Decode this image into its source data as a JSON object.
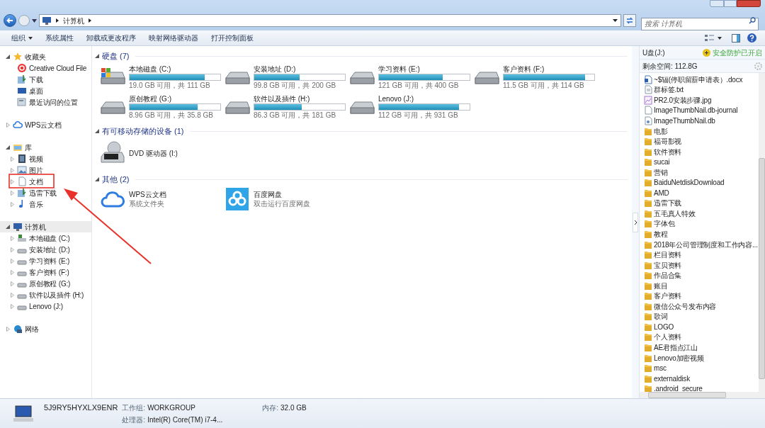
{
  "address": {
    "crumbs": [
      "计算机"
    ]
  },
  "search": {
    "placeholder": "搜索 计算机"
  },
  "toolbar": [
    {
      "label": "组织",
      "dropdown": true
    },
    {
      "label": "系统属性",
      "dropdown": false
    },
    {
      "label": "卸载或更改程序",
      "dropdown": false
    },
    {
      "label": "映射网络驱动器",
      "dropdown": false
    },
    {
      "label": "打开控制面板",
      "dropdown": false
    }
  ],
  "sidebar": [
    {
      "label": "收藏夹",
      "kind": "star",
      "expanded": true,
      "selected": false,
      "children": [
        {
          "label": "Creative Cloud File",
          "kind": "cloud-red",
          "selected": false
        },
        {
          "label": "下载",
          "kind": "download",
          "selected": false
        },
        {
          "label": "桌面",
          "kind": "desktop",
          "selected": false
        },
        {
          "label": "最近访问的位置",
          "kind": "recent",
          "selected": false
        }
      ]
    },
    {
      "label": "WPS云文档",
      "kind": "cloud",
      "expanded": false,
      "selected": false
    },
    {
      "label": "库",
      "kind": "library",
      "expanded": true,
      "selected": false,
      "children": [
        {
          "label": "视频",
          "kind": "video",
          "expanded": false,
          "selected": false
        },
        {
          "label": "图片",
          "kind": "picture",
          "expanded": false,
          "selected": false
        },
        {
          "label": "文档",
          "kind": "document",
          "expanded": false,
          "selected": false
        },
        {
          "label": "迅雷下载",
          "kind": "download",
          "expanded": false,
          "selected": false
        },
        {
          "label": "音乐",
          "kind": "music",
          "expanded": false,
          "selected": false
        }
      ]
    },
    {
      "label": "计算机",
      "kind": "computer",
      "expanded": true,
      "selected": true,
      "children": [
        {
          "label": "本地磁盘 (C:)",
          "kind": "system-drive",
          "expanded": false,
          "selected": false
        },
        {
          "label": "安装地址 (D:)",
          "kind": "drive",
          "expanded": false,
          "selected": false
        },
        {
          "label": "学习资料 (E:)",
          "kind": "drive",
          "expanded": false,
          "selected": false
        },
        {
          "label": "客户资料 (F:)",
          "kind": "drive",
          "expanded": false,
          "selected": false
        },
        {
          "label": "原创教程 (G:)",
          "kind": "drive",
          "expanded": false,
          "selected": false
        },
        {
          "label": "软件以及插件 (H:)",
          "kind": "drive",
          "expanded": false,
          "selected": false
        },
        {
          "label": "Lenovo (J:)",
          "kind": "drive",
          "expanded": false,
          "selected": false
        }
      ]
    },
    {
      "label": "网络",
      "kind": "network",
      "expanded": false,
      "selected": false
    }
  ],
  "groups": [
    {
      "title": "硬盘 (7)",
      "kind": "drives",
      "items": [
        {
          "name": "本地磁盘 (C:)",
          "kind": "system-drive",
          "level": 0.83,
          "info": "19.0 GB 可用，共 111 GB"
        },
        {
          "name": "安装地址 (D:)",
          "kind": "drive",
          "level": 0.5,
          "info": "99.8 GB 可用，共 200 GB"
        },
        {
          "name": "学习资料 (E:)",
          "kind": "drive",
          "level": 0.7,
          "info": "121 GB 可用，共 400 GB"
        },
        {
          "name": "客户资料 (F:)",
          "kind": "drive",
          "level": 0.9,
          "info": "11.5 GB 可用，共 114 GB"
        },
        {
          "name": "原创教程 (G:)",
          "kind": "drive",
          "level": 0.75,
          "info": "8.96 GB 可用，共 35.8 GB"
        },
        {
          "name": "软件以及插件 (H:)",
          "kind": "drive",
          "level": 0.52,
          "info": "86.3 GB 可用，共 181 GB"
        },
        {
          "name": "Lenovo (J:)",
          "kind": "drive",
          "level": 0.88,
          "info": "112 GB 可用，共 931 GB"
        }
      ]
    },
    {
      "title": "有可移动存储的设备 (1)",
      "kind": "devices",
      "items": [
        {
          "name": "DVD 驱动器 (I:)",
          "kind": "dvd"
        }
      ]
    },
    {
      "title": "其他 (2)",
      "kind": "others",
      "items": [
        {
          "name": "WPS云文档",
          "kind": "cloud",
          "info": "系统文件夹"
        },
        {
          "name": "百度网盘",
          "kind": "baidu",
          "info": "双击运行百度网盘"
        }
      ]
    }
  ],
  "usb_panel": {
    "title": "U盘(J:)",
    "protection": "安全防护已开启",
    "free_space": "剩余空间: 112.8G",
    "files": [
      {
        "name": "~$辐(停职留薪申请表）.docx",
        "kind": "doc"
      },
      {
        "name": "群标签.txt",
        "kind": "txt"
      },
      {
        "name": "PR2.0安装步骤.jpg",
        "kind": "image"
      },
      {
        "name": "ImageThumbNail.db-journal",
        "kind": "file"
      },
      {
        "name": "ImageThumbNail.db",
        "kind": "db"
      },
      {
        "name": "电影",
        "kind": "folder"
      },
      {
        "name": "福哥影视",
        "kind": "folder"
      },
      {
        "name": "软件资料",
        "kind": "folder"
      },
      {
        "name": "sucai",
        "kind": "folder"
      },
      {
        "name": "营销",
        "kind": "folder"
      },
      {
        "name": "BaiduNetdiskDownload",
        "kind": "folder"
      },
      {
        "name": "AMD",
        "kind": "folder"
      },
      {
        "name": "迅雷下载",
        "kind": "folder"
      },
      {
        "name": "五毛真人特效",
        "kind": "folder"
      },
      {
        "name": "字体包",
        "kind": "folder"
      },
      {
        "name": "教程",
        "kind": "folder"
      },
      {
        "name": "2018年公司管理制度和工作内容...",
        "kind": "folder"
      },
      {
        "name": "栏目资料",
        "kind": "folder"
      },
      {
        "name": "宝贝资料",
        "kind": "folder"
      },
      {
        "name": "作品合集",
        "kind": "folder"
      },
      {
        "name": "账目",
        "kind": "folder"
      },
      {
        "name": "客户资料",
        "kind": "folder"
      },
      {
        "name": "微信公众号发布内容",
        "kind": "folder"
      },
      {
        "name": "歌词",
        "kind": "folder"
      },
      {
        "name": "LOGO",
        "kind": "folder"
      },
      {
        "name": "个人资料",
        "kind": "folder"
      },
      {
        "name": "AE君指点江山",
        "kind": "folder"
      },
      {
        "name": "Lenovo加密视频",
        "kind": "folder"
      },
      {
        "name": "msc",
        "kind": "folder"
      },
      {
        "name": "externaldisk",
        "kind": "folder"
      },
      {
        "name": ".android_secure",
        "kind": "folder"
      }
    ]
  },
  "details": {
    "computer_name": "5J9RY5HYXLX9ENR",
    "fields": [
      {
        "label": "工作组:",
        "value": "WORKGROUP"
      },
      {
        "label": "内存:",
        "value": "32.0 GB"
      },
      {
        "label": "处理器:",
        "value": "Intel(R) Core(TM) i7-4..."
      }
    ]
  }
}
